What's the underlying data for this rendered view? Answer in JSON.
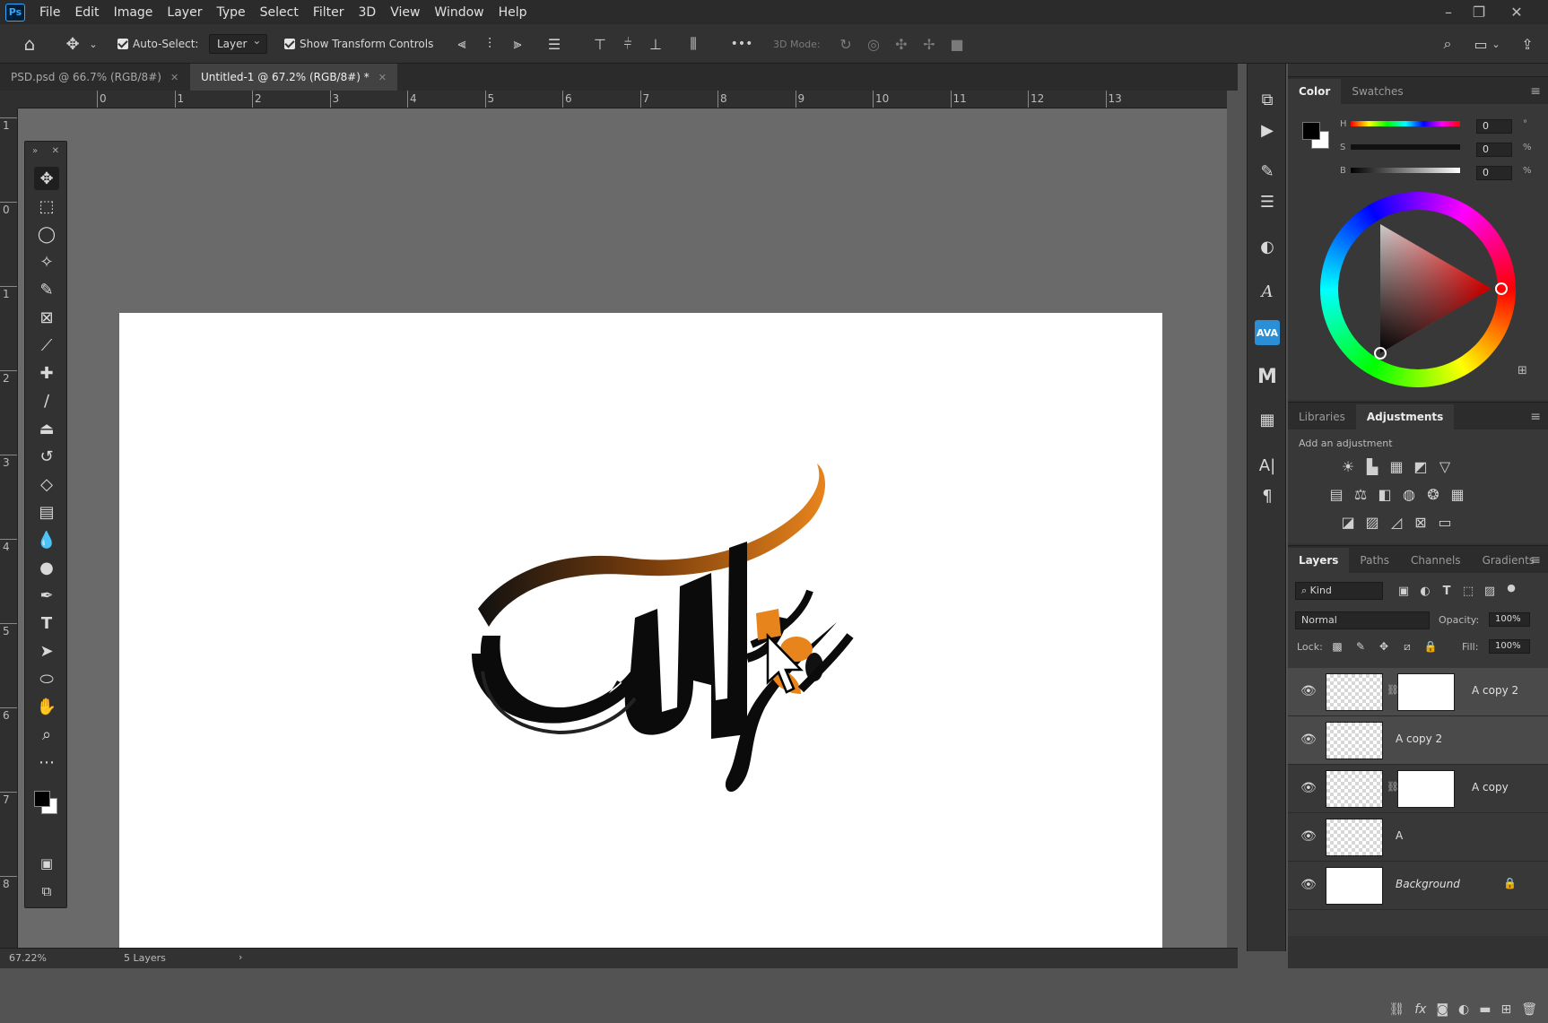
{
  "app": {
    "logo": "Ps"
  },
  "menu": [
    "File",
    "Edit",
    "Image",
    "Layer",
    "Type",
    "Select",
    "Filter",
    "3D",
    "View",
    "Window",
    "Help"
  ],
  "window_controls": {
    "minimize": "–",
    "restore": "❐",
    "close": "✕"
  },
  "options": {
    "auto_select_label": "Auto-Select:",
    "auto_select_target": "Layer",
    "show_transform_label": "Show Transform Controls",
    "mode_3d_label": "3D Mode:",
    "more_label": "•••"
  },
  "tabs": [
    {
      "label": "PSD.psd @ 66.7% (RGB/8#)",
      "active": false
    },
    {
      "label": "Untitled-1 @ 67.2% (RGB/8#) *",
      "active": true
    }
  ],
  "rulers": {
    "horizontal": [
      "0",
      "1",
      "2",
      "3",
      "4",
      "5",
      "6",
      "7",
      "8",
      "9",
      "10",
      "11",
      "12",
      "13"
    ],
    "vertical": [
      "1",
      "0",
      "1",
      "2",
      "3",
      "4",
      "5",
      "6",
      "7",
      "8"
    ]
  },
  "status": {
    "zoom": "67.22%",
    "info": "5 Layers",
    "arrow": "›"
  },
  "color_panel": {
    "tabs": [
      "Color",
      "Swatches"
    ],
    "active_tab": "Color",
    "channels": [
      {
        "label": "H",
        "value": "0",
        "unit": "°"
      },
      {
        "label": "S",
        "value": "0",
        "unit": "%"
      },
      {
        "label": "B",
        "value": "0",
        "unit": "%"
      }
    ],
    "foreground_color": "#000000",
    "background_color": "#ffffff"
  },
  "adjustments_panel": {
    "tabs": [
      "Libraries",
      "Adjustments"
    ],
    "active_tab": "Adjustments",
    "hint": "Add an adjustment"
  },
  "layers_panel": {
    "tabs": [
      "Layers",
      "Paths",
      "Channels",
      "Gradients"
    ],
    "active_tab": "Layers",
    "filter_label": "Kind",
    "blend_mode": "Normal",
    "opacity_label": "Opacity:",
    "opacity_value": "100%",
    "lock_label": "Lock:",
    "fill_label": "Fill:",
    "fill_value": "100%",
    "layers": [
      {
        "name": "A copy 2",
        "has_mask": true,
        "selected": true
      },
      {
        "name": "A copy 2",
        "has_mask": false,
        "selected": true
      },
      {
        "name": "A copy",
        "has_mask": true,
        "selected": false
      },
      {
        "name": "A",
        "has_mask": false,
        "selected": false
      },
      {
        "name": "Background",
        "has_mask": false,
        "selected": false,
        "locked": true
      }
    ]
  },
  "colors": {
    "accent_orange": "#e8841c",
    "ps_blue": "#31a8ff"
  }
}
